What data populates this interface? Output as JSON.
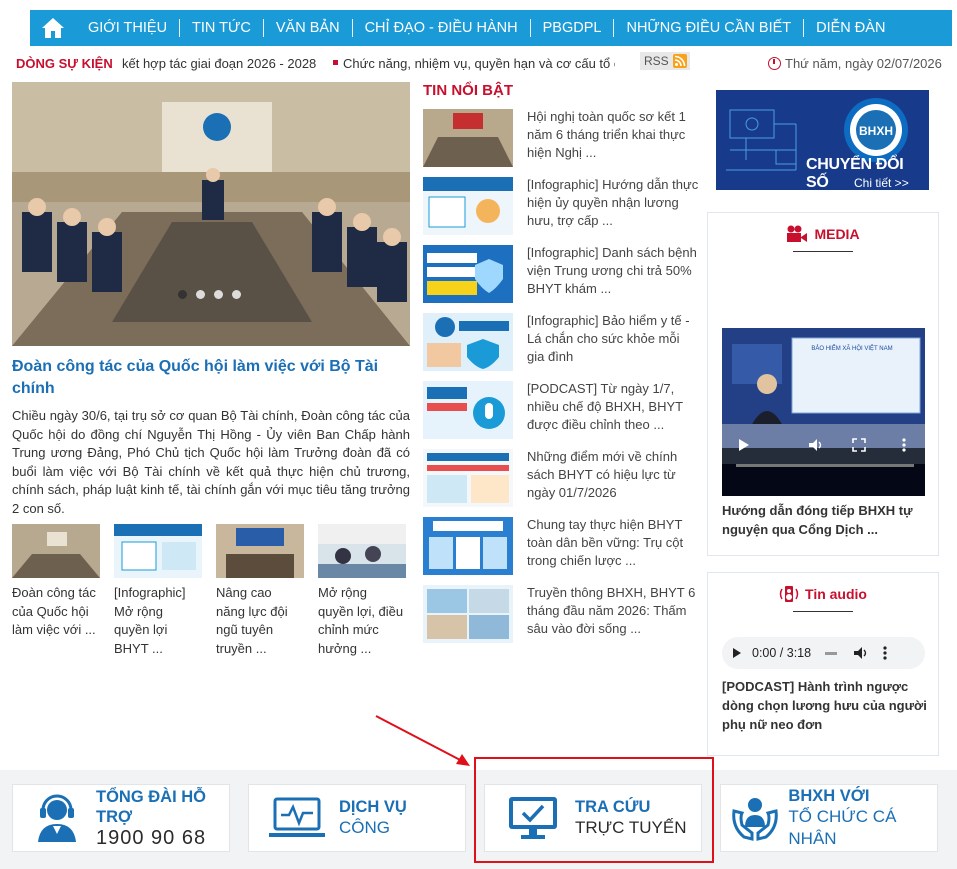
{
  "nav": {
    "items": [
      "GIỚI THIỆU",
      "TIN TỨC",
      "VĂN BẢN",
      "CHỈ ĐẠO - ĐIỀU HÀNH",
      "PBGDPL",
      "NHỮNG ĐIỀU CẦN BIẾT",
      "DIỄN ĐÀN"
    ]
  },
  "ticker": {
    "label": "DÒNG SỰ KIỆN",
    "item1": "kết hợp tác giai đoạn 2026 - 2028",
    "item2": "Chức năng, nhiệm vụ, quyền hạn và cơ cấu tổ chức",
    "rss": "RSS",
    "date": "Thứ năm, ngày 02/07/2026"
  },
  "feature": {
    "title": "Đoàn công tác của Quốc hội làm việc với Bộ Tài chính",
    "desc": "Chiều ngày 30/6, tại trụ sở cơ quan Bộ Tài chính, Đoàn công tác của Quốc hội do đồng chí Nguyễn Thị Hồng - Ủy viên Ban Chấp hành Trung ương Đảng, Phó Chủ tịch Quốc hội làm Trưởng đoàn đã có buổi làm việc với Bộ Tài chính về kết quả thực hiện chủ trương, chính sách, pháp luật kinh tế, tài chính gắn với mục tiêu tăng trưởng 2 con số."
  },
  "thumbs": [
    {
      "caption": "Đoàn công tác của Quốc hội làm việc với ..."
    },
    {
      "caption": "[Infographic] Mở rộng quyền lợi BHYT ..."
    },
    {
      "caption": "Nâng cao năng lực đội ngũ tuyên truyền ..."
    },
    {
      "caption": "Mở rộng quyền lợi, điều chỉnh mức hưởng ..."
    }
  ],
  "highlights": {
    "title": "TIN NỔI BẬT",
    "items": [
      "Hội nghị toàn quốc sơ kết 1 năm 6 tháng triển khai thực hiện Nghị ...",
      "[Infographic] Hướng dẫn thực hiện ủy quyền nhận lương hưu, trợ cấp ...",
      "[Infographic] Danh sách bệnh viện Trung ương chi trả 50% BHYT khám ...",
      "[Infographic] Bảo hiểm y tế - Lá chắn cho sức khỏe mỗi gia đình",
      "[PODCAST] Từ ngày 1/7, nhiều chế độ BHXH, BHYT được điều chỉnh theo ...",
      "Những điểm mới về chính sách BHYT có hiệu lực từ ngày 01/7/2026",
      "Chung tay thực hiện BHYT toàn dân bền vững: Trụ cột trong chiến lược ...",
      "Truyền thông BHXH, BHYT 6 tháng đầu năm 2026: Thấm sâu vào đời sống ..."
    ]
  },
  "banner": {
    "title": "CHUYỂN ĐỔI SỐ",
    "link": "Chi tiết >>"
  },
  "media": {
    "title": "MEDIA",
    "caption": "Hướng dẫn đóng tiếp BHXH tự nguyện qua Cổng Dịch ..."
  },
  "audio": {
    "title": "Tin audio",
    "time": "0:00 / 3:18",
    "caption": "[PODCAST] Hành trình ngược dòng chọn lương hưu của người phụ nữ neo đơn"
  },
  "bottom": {
    "cards": [
      {
        "line1": "TỔNG ĐÀI HỖ TRỢ",
        "line2": "1900 90 68",
        "icon": "headset-icon"
      },
      {
        "line1": "DỊCH VỤ",
        "line2": "CÔNG",
        "icon": "monitor-pulse-icon"
      },
      {
        "line1": "TRA CỨU",
        "line2": "TRỰC TUYẾN",
        "icon": "monitor-check-icon"
      },
      {
        "line1": "BHXH VỚI",
        "line2": "TỔ CHỨC CÁ NHÂN",
        "icon": "hands-person-icon"
      }
    ]
  },
  "colors": {
    "nav_bg": "#1a9bd7",
    "accent_red": "#c8102e",
    "link_blue": "#1a6fb5",
    "highlight_box": "#e0101a"
  }
}
